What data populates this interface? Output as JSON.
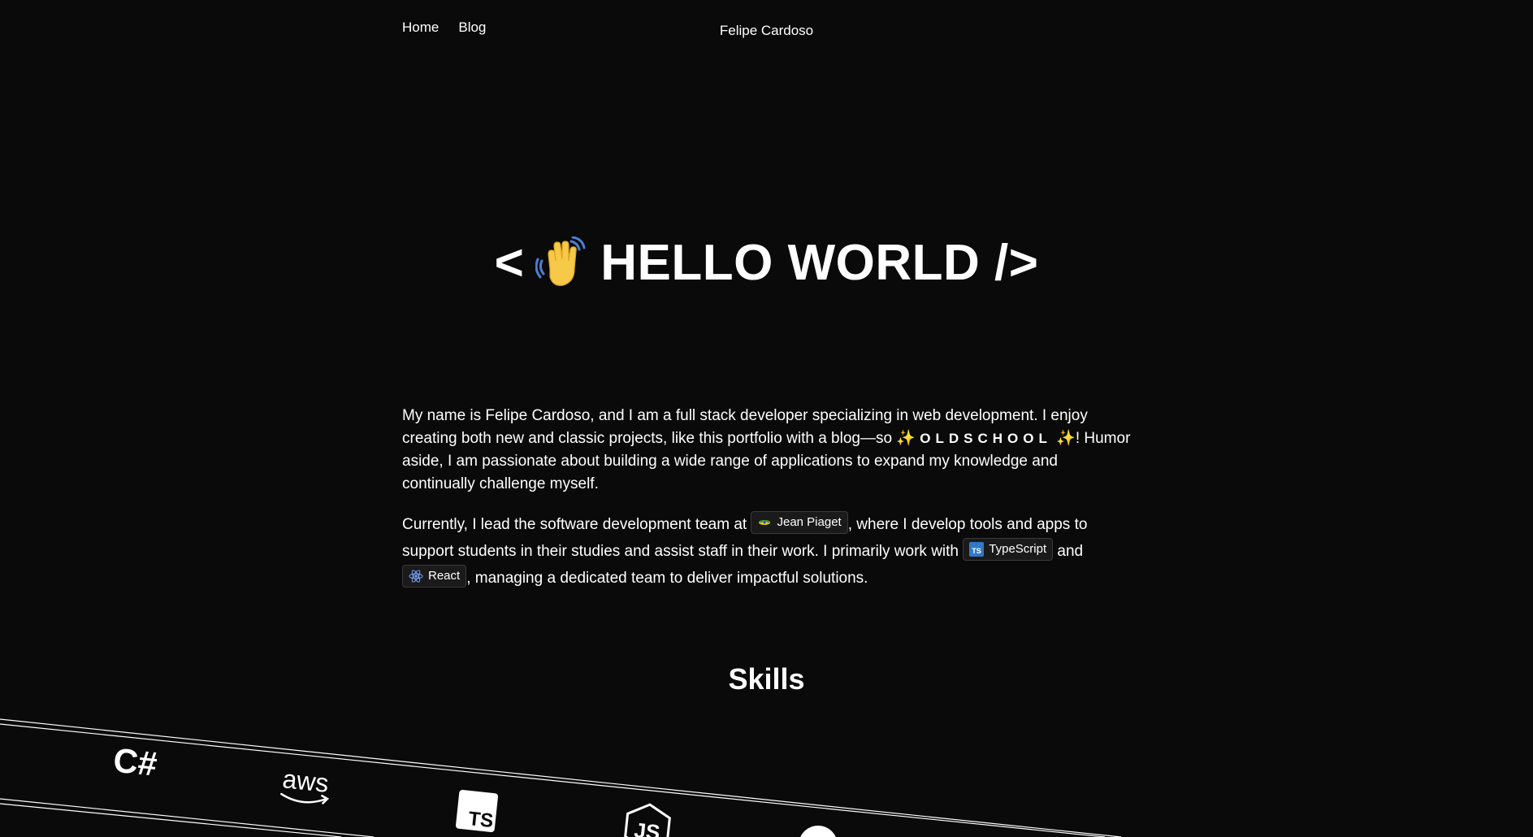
{
  "nav": {
    "home": "Home",
    "blog": "Blog"
  },
  "site": {
    "name": "Felipe Cardoso"
  },
  "hero": {
    "open": "<",
    "wave_emoji": "👋",
    "text": "HELLO WORLD />"
  },
  "bio": {
    "p1_a": "My name is Felipe Cardoso, and I am a full stack developer specializing in web development. I enjoy creating both new and classic projects, like this portfolio with a blog—so ",
    "sparkle": "✨",
    "oldschool": "OLDSCHOOL",
    "p1_b": "! Humor aside, I am passionate about building a wide range of applications to expand my knowledge and continually challenge myself.",
    "p2_a": "Currently, I lead the software development team at ",
    "company_chip": "Jean Piaget",
    "p2_b": ", where I develop tools and apps to support students in their studies and assist staff in their work. I primarily work with ",
    "ts_chip": "TypeScript",
    "p2_c": " and ",
    "react_chip": "React",
    "p2_d": ", managing a dedicated team to deliver impactful solutions."
  },
  "skills": {
    "title": "Skills",
    "logos": [
      "csharp-icon",
      "aws-icon",
      "typescript-icon",
      "nodejs-icon",
      "circle-icon"
    ],
    "csharp_text": "C#",
    "aws_text": "aws",
    "ts_text": "TS",
    "js_text": "JS"
  },
  "colors": {
    "background": "#0a0a0a",
    "text": "#ffffff",
    "chip_bg": "#1a1a1a",
    "chip_border": "#3a3a3a",
    "sparkle": "#f5c518",
    "typescript_blue": "#3178c6",
    "react_blue": "#61dafb"
  }
}
